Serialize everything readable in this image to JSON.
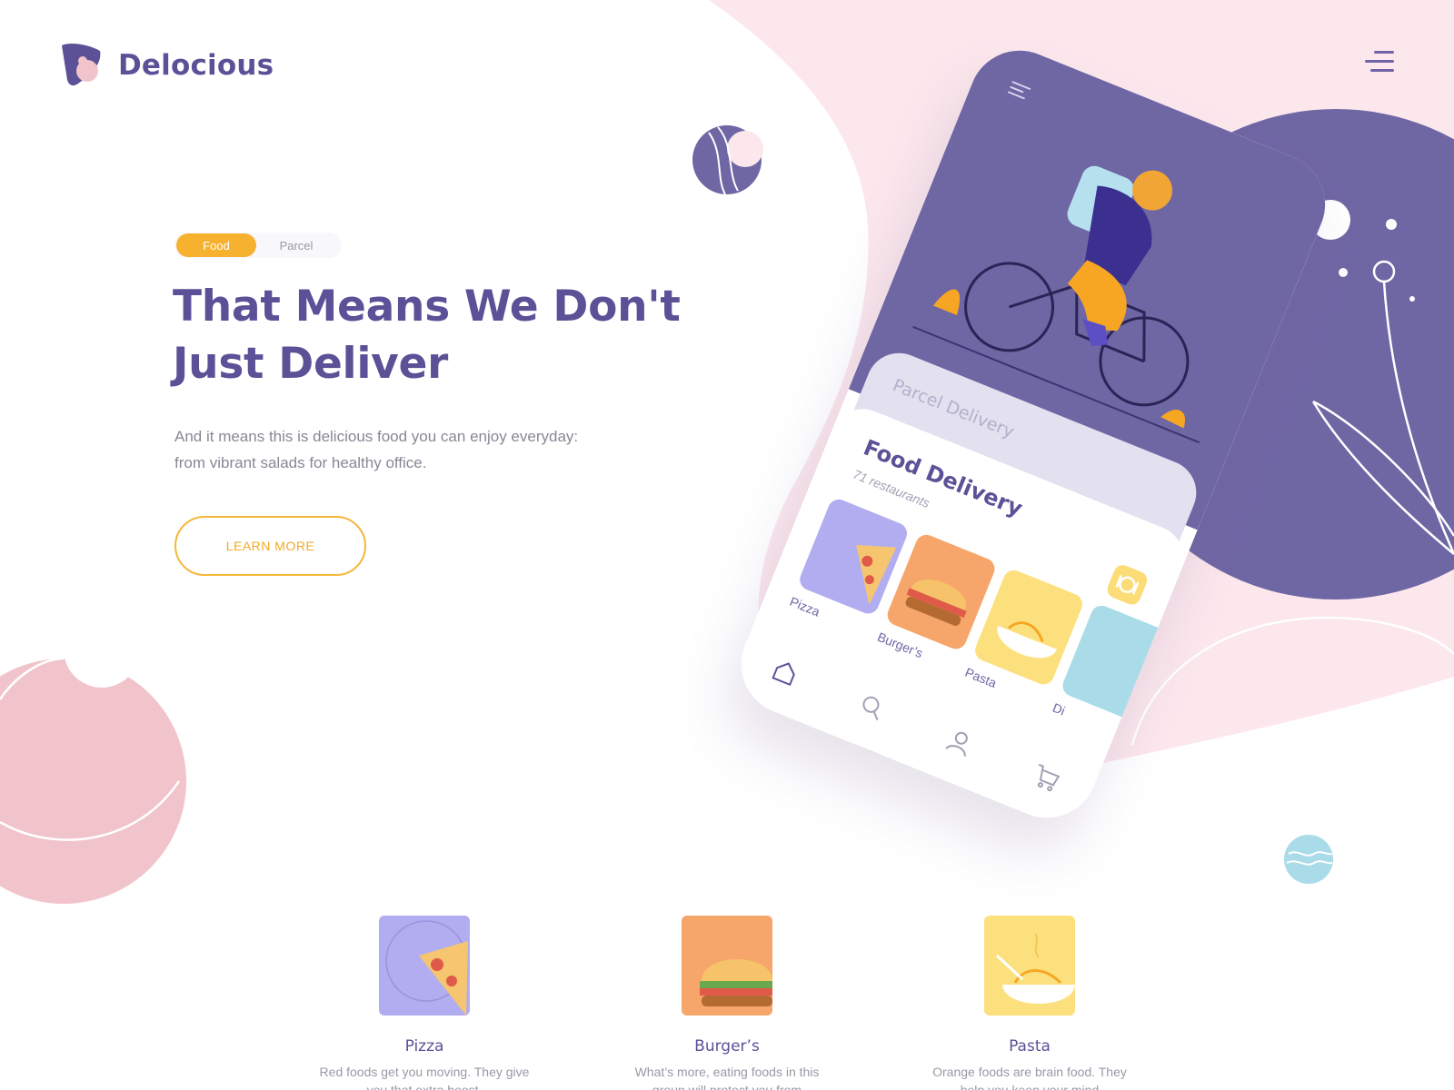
{
  "brand": {
    "name": "Delocious"
  },
  "hero": {
    "tabs": [
      "Food",
      "Parcel"
    ],
    "active_tab": "Food",
    "title_line1": "That Means We Don't",
    "title_line2": "Just Deliver",
    "subtitle_line1": "And it means this is delicious food you can enjoy everyday:",
    "subtitle_line2": "from vibrant salads for healthy office.",
    "cta_label": "LEARN MORE"
  },
  "phone": {
    "parcel_label": "Parcel Delivery",
    "food_title": "Food Delivery",
    "food_count": "71 restaurants",
    "categories": [
      "Pizza",
      "Burger’s",
      "Pasta",
      "Di"
    ],
    "nav_icons": [
      "home-icon",
      "search-icon",
      "user-icon",
      "cart-icon"
    ]
  },
  "features": [
    {
      "title": "Pizza",
      "desc_line1": "Red foods get you moving. They give",
      "desc_line2": "you that extra boost."
    },
    {
      "title": "Burger’s",
      "desc_line1": "What’s more, eating foods in this",
      "desc_line2": "group will protect you from"
    },
    {
      "title": "Pasta",
      "desc_line1": "Orange foods are brain food. They",
      "desc_line2": "help you keep your mind"
    }
  ],
  "colors": {
    "brand_purple": "#5c5197",
    "phone_purple": "#6f66a4",
    "accent_orange": "#f6b12e",
    "blob_pink": "#fbe7ec",
    "circle_pink": "#f1c4cc",
    "circle_blue": "#a9dbe8"
  }
}
